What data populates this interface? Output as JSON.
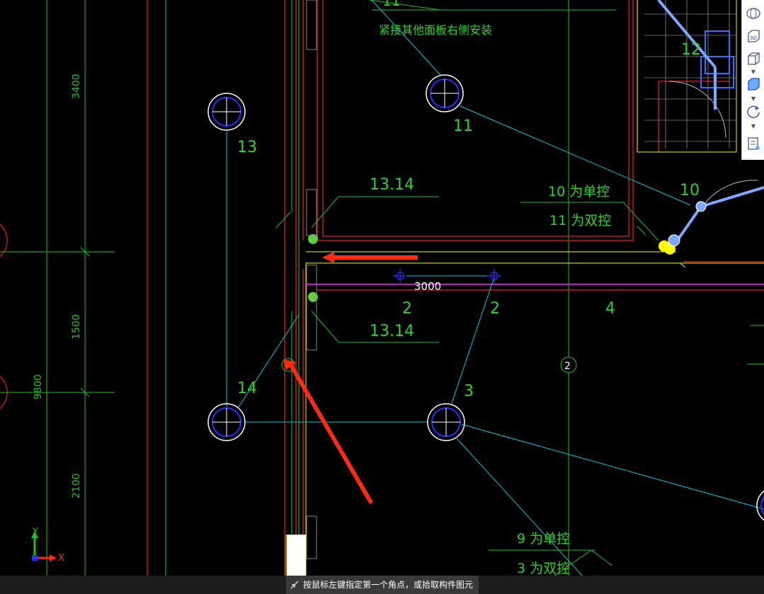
{
  "drawing": {
    "note_top": "紧接其他面板右侧安装",
    "label_top_cut": "11",
    "dims_vertical": [
      "3400",
      "1500",
      "9800",
      "2100"
    ],
    "fixtures": [
      {
        "id": "13",
        "label": "13"
      },
      {
        "id": "11",
        "label": "11"
      },
      {
        "id": "14",
        "label": "14"
      },
      {
        "id": "3",
        "label": "3"
      },
      {
        "id": "10",
        "label": "10"
      },
      {
        "id": "12",
        "label": "12"
      }
    ],
    "switch_labels": {
      "upper": "13.14",
      "lower": "13.14",
      "single_10": "10 为单控",
      "double_11": "11 为双控",
      "single_9": "9 为单控",
      "double_3": "3 为双控"
    },
    "dim_3000": "3000",
    "circuit_labels": {
      "a": "2",
      "b": "2",
      "c": "4"
    },
    "axis_bubble": "2"
  },
  "ucs": {
    "y_label": "Y",
    "x_label": "X"
  },
  "toolbar": {
    "icons": [
      "navcube-icon",
      "3d-view-icon",
      "box-view-icon",
      "box-view-blue-icon",
      "orbit-icon",
      "layer-list-icon"
    ]
  },
  "status": {
    "prompt": "按鼠标左键指定第一个角点，或拾取构件图元"
  },
  "colors": {
    "background": "#000000",
    "wire": "#00c8d8",
    "grid": "#1fbf1f",
    "wall": "#c01818",
    "annotation": "#ff2a12",
    "highlight": "#ffff00"
  }
}
